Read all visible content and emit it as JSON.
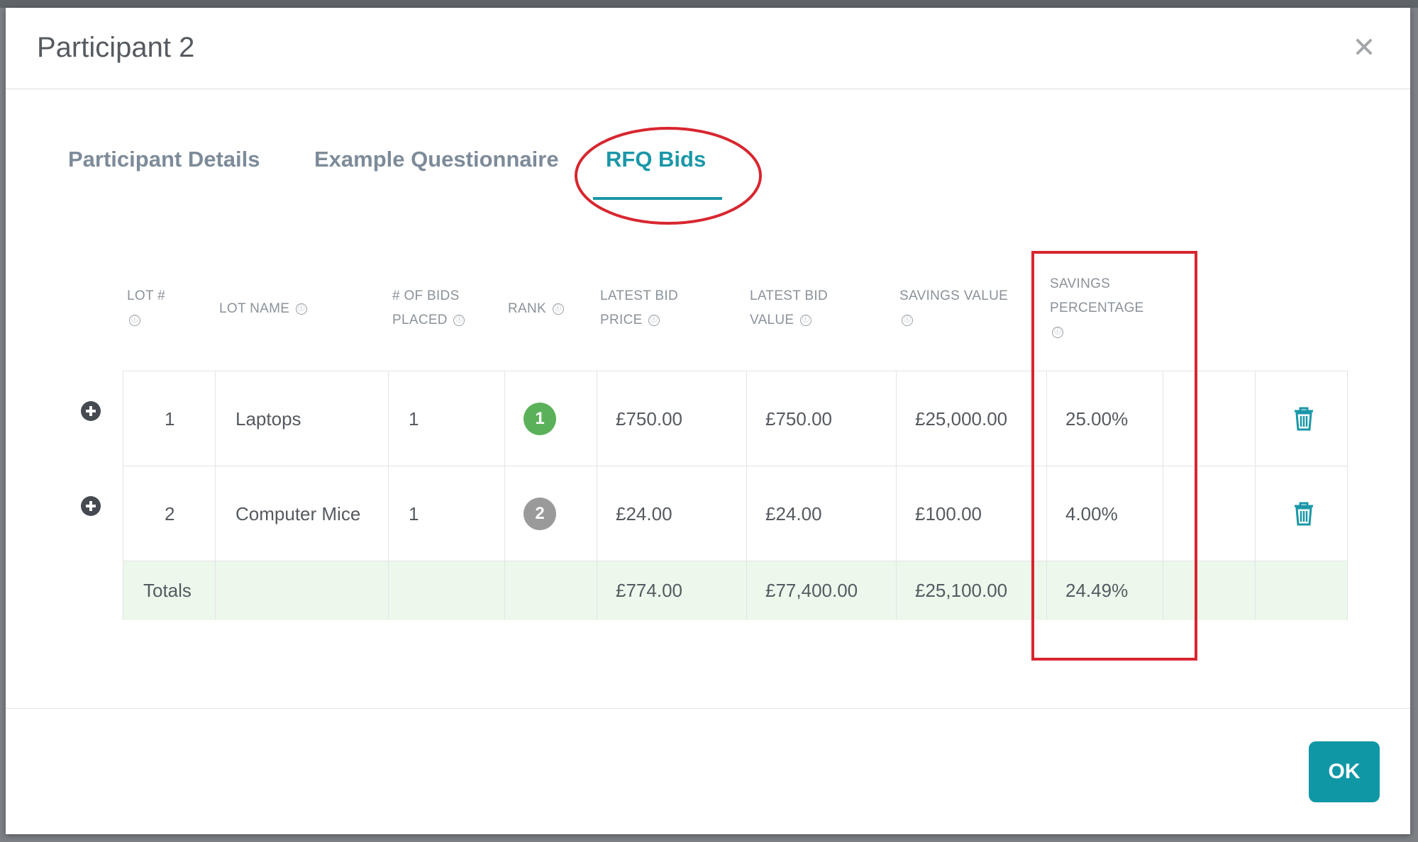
{
  "modal": {
    "title": "Participant 2",
    "close_icon": "close-icon"
  },
  "tabs": [
    {
      "label": "Participant Details",
      "active": false
    },
    {
      "label": "Example Questionnaire",
      "active": false
    },
    {
      "label": "RFQ Bids",
      "active": true
    }
  ],
  "colors": {
    "accent": "#1a97a8",
    "annotation_red": "#d8262f",
    "rank_first": "#5bb15a",
    "rank_other": "#9a9a9a",
    "totals_row": "#ecf8ec"
  },
  "table": {
    "columns": [
      {
        "line1": "LOT #",
        "line2": "",
        "info": "ⓘ"
      },
      {
        "line1": "LOT NAME",
        "line2": "",
        "info": "ⓘ"
      },
      {
        "line1": "# OF BIDS",
        "line2": "PLACED",
        "info": "ⓘ"
      },
      {
        "line1": "RANK",
        "line2": "",
        "info": "ⓘ"
      },
      {
        "line1": "LATEST BID",
        "line2": "PRICE",
        "info": "ⓘ"
      },
      {
        "line1": "LATEST BID",
        "line2": "VALUE",
        "info": "ⓘ"
      },
      {
        "line1": "SAVINGS VALUE",
        "line2": "",
        "info": "ⓘ"
      },
      {
        "line1": "SAVINGS",
        "line2": "PERCENTAGE",
        "info": "ⓘ"
      }
    ],
    "rows": [
      {
        "lot": "1",
        "name": "Laptops",
        "bids": "1",
        "rank": "1",
        "price": "£750.00",
        "value": "£750.00",
        "savings_value": "£25,000.00",
        "savings_pct": "25.00%"
      },
      {
        "lot": "2",
        "name": "Computer Mice",
        "bids": "1",
        "rank": "2",
        "price": "£24.00",
        "value": "£24.00",
        "savings_value": "£100.00",
        "savings_pct": "4.00%"
      }
    ],
    "totals": {
      "label": "Totals",
      "price": "£774.00",
      "value": "£77,400.00",
      "savings_value": "£25,100.00",
      "savings_pct": "24.49%"
    }
  },
  "footer": {
    "ok_label": "OK"
  }
}
